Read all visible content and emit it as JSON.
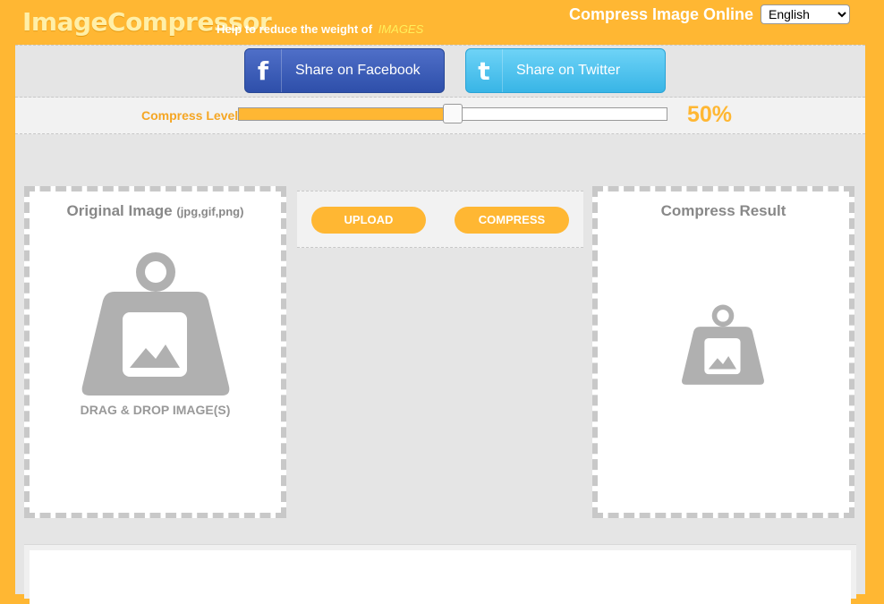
{
  "header": {
    "logo": "ImageCompressor",
    "tagline": "Help to reduce the weight of",
    "tagline_accent": "IMAGES",
    "title": "Compress Image Online",
    "language": {
      "selected": "English",
      "options": [
        "English"
      ]
    }
  },
  "share": {
    "facebook_label": "Share on Facebook",
    "facebook_icon": "f",
    "twitter_label": "Share on Twitter",
    "twitter_icon": "t"
  },
  "compress_level": {
    "label": "Compress Level",
    "value": 50,
    "display": "50%"
  },
  "original": {
    "title": "Original Image",
    "formats": "(jpg,gif,png)",
    "drag_text": "DRAG & DROP IMAGE(S)"
  },
  "actions": {
    "upload_label": "UPLOAD",
    "compress_label": "COMPRESS"
  },
  "result": {
    "title": "Compress Result"
  },
  "colors": {
    "brand": "#FFB733",
    "facebook": "#3B5BB5",
    "twitter": "#45BCEC"
  }
}
